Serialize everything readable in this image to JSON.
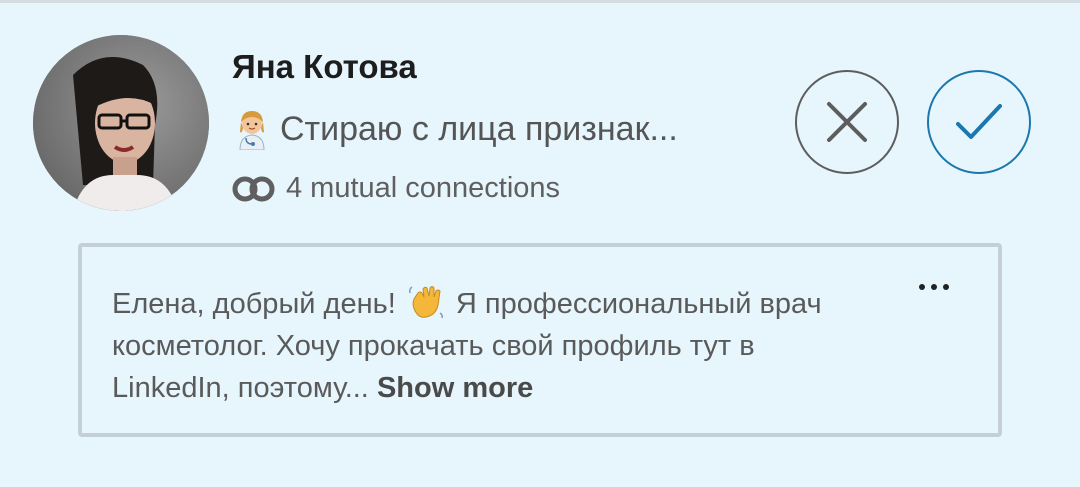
{
  "invitation": {
    "name": "Яна Котова",
    "headline_emoji": "health-worker-emoji",
    "headline": "Стираю с лица признак...",
    "mutual_connections": "4 mutual connections"
  },
  "message": {
    "text_part1": "Елена, добрый день!",
    "wave_emoji": "waving-hand-emoji",
    "text_part2": "Я профессиональный врач косметолог. Хочу прокачать свой профиль тут в LinkedIn, поэтому...",
    "show_more_label": "Show more"
  },
  "actions": {
    "ignore_icon": "close-icon",
    "accept_icon": "checkmark-icon",
    "more_icon": "more-options-icon"
  },
  "colors": {
    "background": "#e7f6fd",
    "accent": "#1b77ad",
    "ignore_stroke": "#5d5d5d"
  }
}
